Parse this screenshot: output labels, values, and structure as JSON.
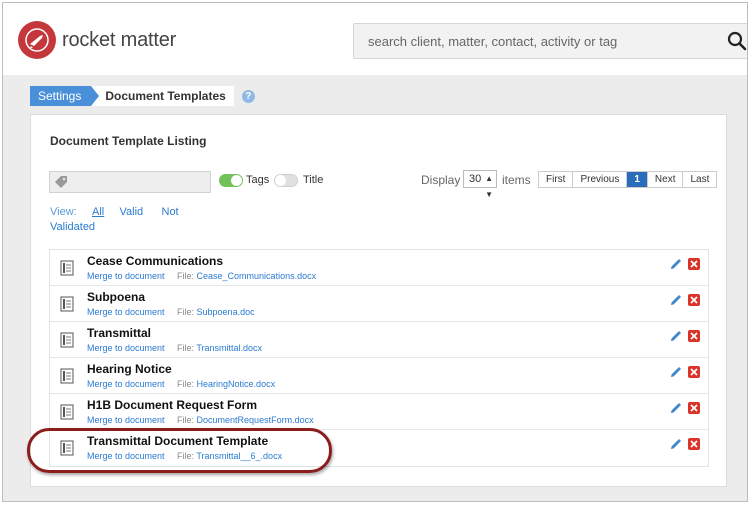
{
  "app": {
    "logo_text": "rocket matter",
    "brand_color": "#c4373d"
  },
  "search": {
    "placeholder": "search client, matter, contact, activity or tag",
    "icon": "search-icon"
  },
  "breadcrumb": {
    "root": "Settings",
    "current": "Document Templates",
    "help": "?"
  },
  "panel": {
    "title": "Document Template Listing",
    "filters": {
      "tags_label": "Tags",
      "tags_on": true,
      "title_label": "Title",
      "title_on": false
    },
    "display": {
      "label": "Display",
      "value": "30",
      "items_label": "items"
    },
    "pager": {
      "first": "First",
      "previous": "Previous",
      "page": "1",
      "next": "Next",
      "last": "Last"
    },
    "view": {
      "label": "View:",
      "all": "All",
      "valid": "Valid",
      "not_validated": "Not Validated"
    }
  },
  "templates": [
    {
      "title": "Cease Communications",
      "merge": "Merge to document",
      "file_label": "File:",
      "file": "Cease_Communications.docx"
    },
    {
      "title": "Subpoena",
      "merge": "Merge to document",
      "file_label": "File:",
      "file": "Subpoena.doc"
    },
    {
      "title": "Transmittal",
      "merge": "Merge to document",
      "file_label": "File:",
      "file": "Transmittal.docx"
    },
    {
      "title": "Hearing Notice",
      "merge": "Merge to document",
      "file_label": "File:",
      "file": "HearingNotice.docx"
    },
    {
      "title": "H1B Document Request Form",
      "merge": "Merge to document",
      "file_label": "File:",
      "file": "DocumentRequestForm.docx"
    },
    {
      "title": "Transmittal Document Template",
      "merge": "Merge to document",
      "file_label": "File:",
      "file": "Transmittal__6_.docx"
    }
  ]
}
